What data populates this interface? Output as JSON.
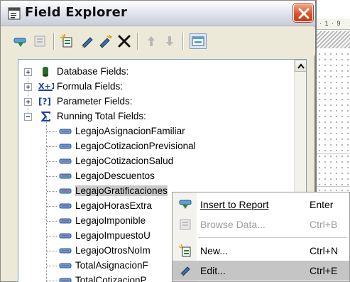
{
  "window": {
    "title": "Field Explorer",
    "close_icon": "close-icon",
    "accent_close": "#e0532d"
  },
  "toolbar": {
    "buttons": [
      {
        "name": "insert-to-report-icon",
        "enabled": true
      },
      {
        "name": "browse-data-icon",
        "enabled": false
      },
      {
        "name": "new-field-icon",
        "enabled": true
      },
      {
        "name": "edit-pencil-icon",
        "enabled": true
      },
      {
        "name": "rename-icon",
        "enabled": true
      },
      {
        "name": "delete-icon",
        "enabled": true
      },
      {
        "name": "move-up-icon",
        "enabled": false
      },
      {
        "name": "move-down-icon",
        "enabled": false
      },
      {
        "name": "show-field-type-icon",
        "enabled": true,
        "active": true
      }
    ]
  },
  "tree": {
    "categories": [
      {
        "label": "Database Fields:",
        "expanded": false,
        "icon": "database-icon"
      },
      {
        "label": "Formula Fields:",
        "expanded": false,
        "icon": "formula-icon"
      },
      {
        "label": "Parameter Fields:",
        "expanded": false,
        "icon": "parameter-icon"
      },
      {
        "label": "Running Total Fields:",
        "expanded": true,
        "icon": "sigma-icon"
      }
    ],
    "running_totals": [
      {
        "label": "LegajoAsignacionFamiliar"
      },
      {
        "label": "LegajoCotizacionPrevisional"
      },
      {
        "label": "LegajoCotizacionSalud"
      },
      {
        "label": "LegajoDescuentos"
      },
      {
        "label": "LegajoGratificaciones",
        "selected": true
      },
      {
        "label": "LegajoHorasExtra"
      },
      {
        "label": "LegajoImponible"
      },
      {
        "label": "LegajoImpuestoU"
      },
      {
        "label": "LegajoOtrosNoIm"
      },
      {
        "label": "TotalAsignacionF"
      },
      {
        "label": "TotalCotizacionP"
      }
    ]
  },
  "ruler": {
    "text": "· 1 · 9"
  },
  "context_menu": {
    "items": [
      {
        "label": "Insert to Report",
        "shortcut": "Enter",
        "enabled": true,
        "icon": "insert-to-report-icon"
      },
      {
        "label": "Browse Data...",
        "shortcut": "Ctrl+B",
        "enabled": false,
        "icon": "browse-data-icon"
      },
      {
        "label": "New...",
        "shortcut": "Ctrl+N",
        "enabled": true,
        "icon": "new-field-icon"
      },
      {
        "label": "Edit...",
        "shortcut": "Ctrl+E",
        "enabled": true,
        "icon": "edit-pencil-icon",
        "highlighted": true
      }
    ]
  }
}
